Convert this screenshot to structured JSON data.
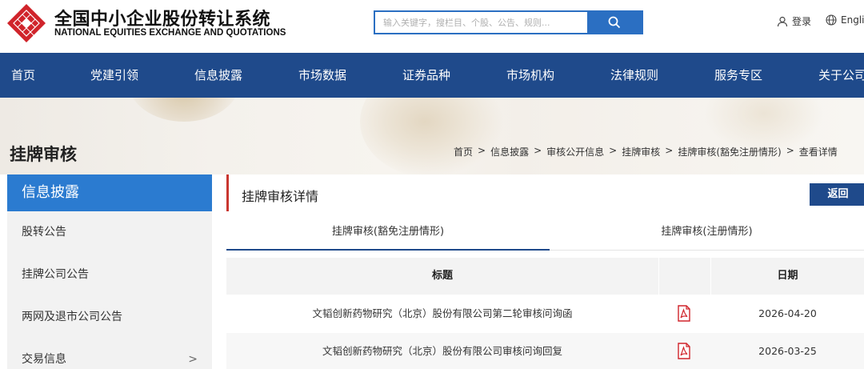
{
  "header": {
    "brand_cn": "全国中小企业股份转让系统",
    "brand_en": "NATIONAL EQUITIES EXCHANGE AND QUOTATIONS",
    "search_placeholder": "输入关键字，搜栏目、个股、公告、规则...",
    "login": "登录",
    "language": "English"
  },
  "nav": [
    "首页",
    "党建引领",
    "信息披露",
    "市场数据",
    "证券品种",
    "市场机构",
    "法律规则",
    "服务专区",
    "关于公司"
  ],
  "banner": {
    "page_title": "挂牌审核",
    "breadcrumb": [
      "首页",
      ">",
      "信息披露",
      ">",
      "审核公开信息",
      ">",
      "挂牌审核",
      ">",
      "挂牌审核(豁免注册情形)",
      ">",
      "查看详情"
    ]
  },
  "sidebar": {
    "heading": "信息披露",
    "items": [
      "股转公告",
      "挂牌公司公告",
      "两网及退市公司公告",
      "交易信息"
    ],
    "submenu_arrow": ">"
  },
  "main": {
    "title": "挂牌审核详情",
    "back_label": "返回",
    "tabs": [
      "挂牌审核(豁免注册情形)",
      "挂牌审核(注册情形)"
    ],
    "table": {
      "columns": [
        "标题",
        "",
        "日期"
      ],
      "rows": [
        {
          "title": "文韬创新药物研究（北京）股份有限公司第二轮审核问询函",
          "icon": "pdf-icon",
          "date": "2026-04-20"
        },
        {
          "title": "文韬创新药物研究（北京）股份有限公司审核问询回复",
          "icon": "pdf-icon",
          "date": "2026-03-25"
        }
      ]
    }
  },
  "colors": {
    "nav_bg": "#1f4a8b",
    "accent_blue": "#2b7bd0",
    "logo_red": "#d0242b",
    "pdf_red": "#d0242b"
  }
}
